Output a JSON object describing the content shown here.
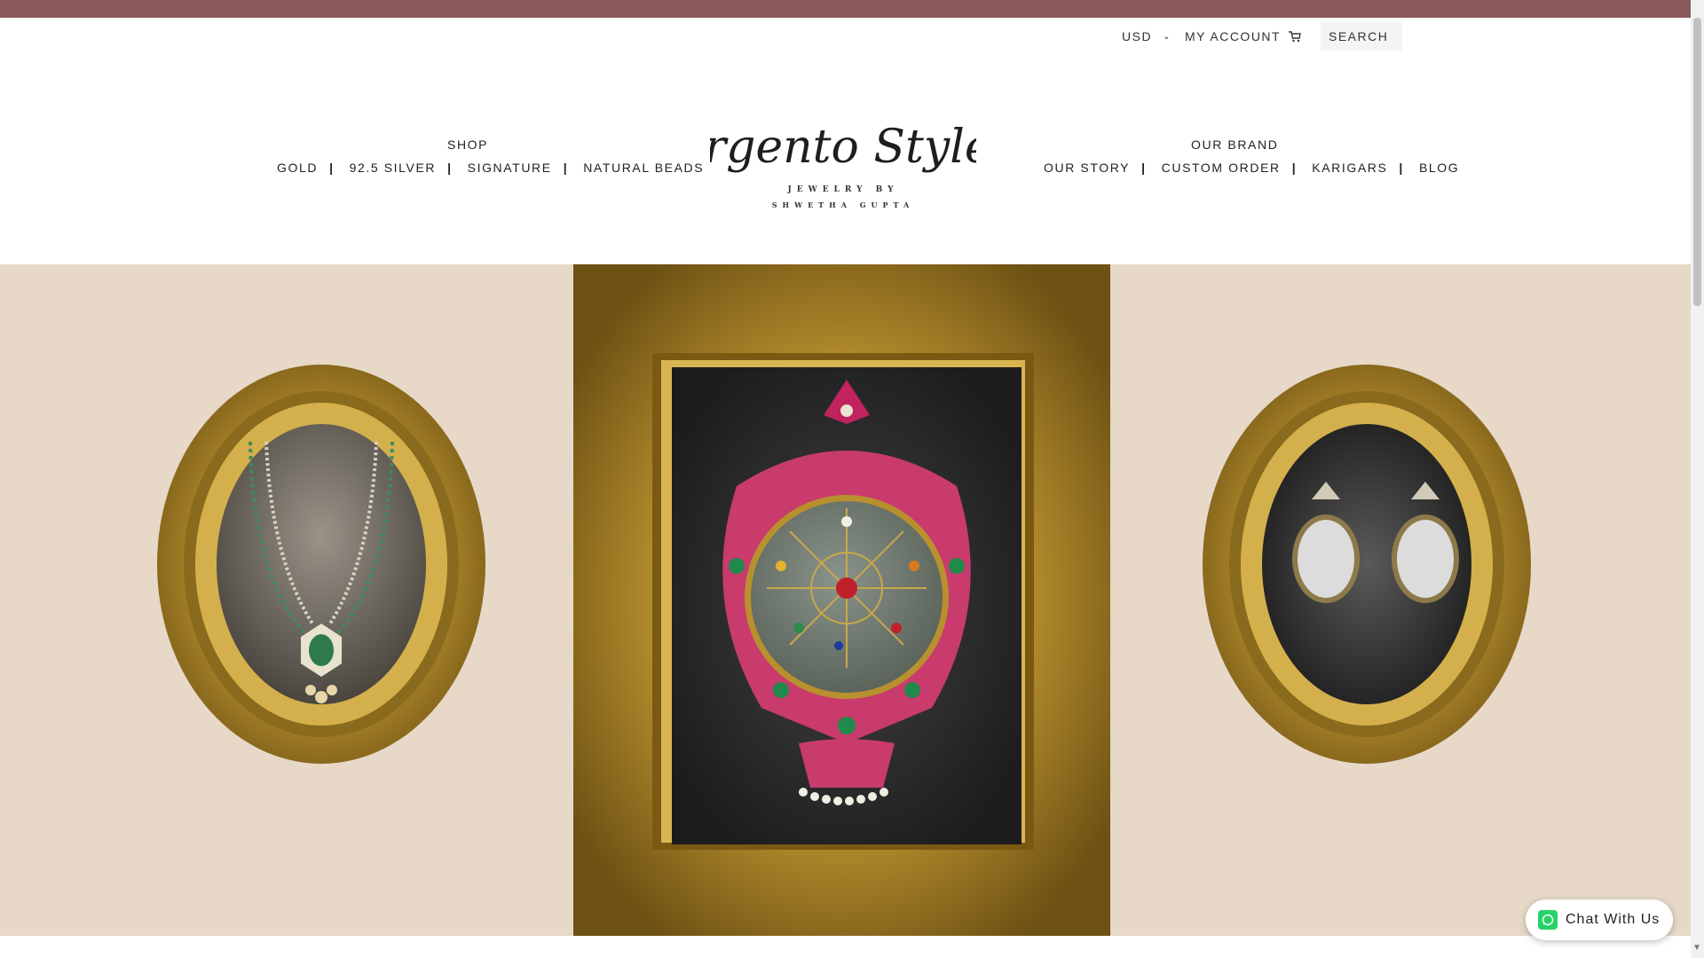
{
  "header": {
    "currency": "USD",
    "my_account": "MY ACCOUNT",
    "search_placeholder": "SEARCH"
  },
  "logo": {
    "script": "Argento Styles",
    "tagline": "JEWELRY BY",
    "designer": "SHWETHA GUPTA"
  },
  "nav_left": {
    "title": "SHOP",
    "items": [
      "GOLD",
      "92.5 SILVER",
      "SIGNATURE",
      "NATURAL BEADS"
    ]
  },
  "nav_right": {
    "title": "OUR BRAND",
    "items": [
      "OUR STORY",
      "CUSTOM ORDER",
      "KARIGARS",
      "BLOG"
    ]
  },
  "chat": {
    "label": "Chat With Us"
  },
  "icons": {
    "cart": "cart-icon",
    "chevron": "chevron-down-icon",
    "whatsapp": "whatsapp-icon"
  },
  "colors": {
    "topbar": "#8b5a5c",
    "hero_background": "#e7d8c8",
    "frame_gold": "#b8902e",
    "whatsapp_green": "#25d366"
  }
}
